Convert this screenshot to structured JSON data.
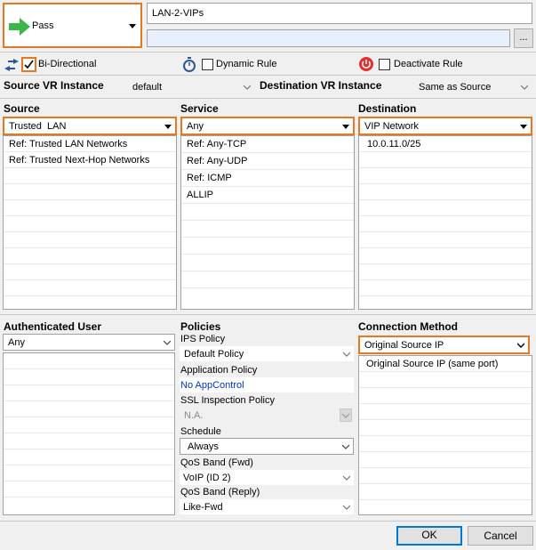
{
  "action": {
    "label": "Pass",
    "color": "#3cb54a"
  },
  "rule_name": {
    "value": "LAN-2-VIPs"
  },
  "rule_comment": {
    "value": "",
    "ellipsis": "..."
  },
  "options": {
    "bidirectional": {
      "label": "Bi-Directional",
      "checked": true
    },
    "dynamic_rule": {
      "label": "Dynamic Rule",
      "checked": false
    },
    "deactivate_rule": {
      "label": "Deactivate Rule",
      "checked": false
    }
  },
  "vr": {
    "source_label": "Source VR Instance",
    "source_value": "default",
    "dest_label": "Destination VR Instance",
    "dest_value": "Same as Source"
  },
  "source": {
    "label": "Source",
    "selected": "Trusted  LAN",
    "items": [
      "Ref: Trusted LAN Networks",
      "Ref: Trusted Next-Hop Networks"
    ]
  },
  "service": {
    "label": "Service",
    "selected": "Any",
    "items": [
      "Ref: Any-TCP",
      "Ref: Any-UDP",
      "Ref: ICMP",
      "ALLIP"
    ]
  },
  "destination": {
    "label": "Destination",
    "selected": "VIP Network",
    "items": [
      "10.0.11.0/25"
    ]
  },
  "auth_user": {
    "label": "Authenticated User",
    "selected": "Any"
  },
  "policies": {
    "label": "Policies",
    "ips_label": "IPS Policy",
    "ips_value": "Default Policy",
    "app_label": "Application Policy",
    "app_value": "No AppControl",
    "ssl_label": "SSL Inspection Policy",
    "ssl_value": "N.A.",
    "schedule_label": "Schedule",
    "schedule_value": "Always",
    "qos_fwd_label": "QoS Band (Fwd)",
    "qos_fwd_value": "VoIP (ID 2)",
    "qos_reply_label": "QoS Band (Reply)",
    "qos_reply_value": "Like-Fwd"
  },
  "connection": {
    "label": "Connection Method",
    "selected": "Original Source IP",
    "items": [
      "Original Source IP (same port)"
    ]
  },
  "buttons": {
    "ok": "OK",
    "cancel": "Cancel"
  },
  "colors": {
    "accent": "#e87722",
    "link": "#0033cc"
  }
}
